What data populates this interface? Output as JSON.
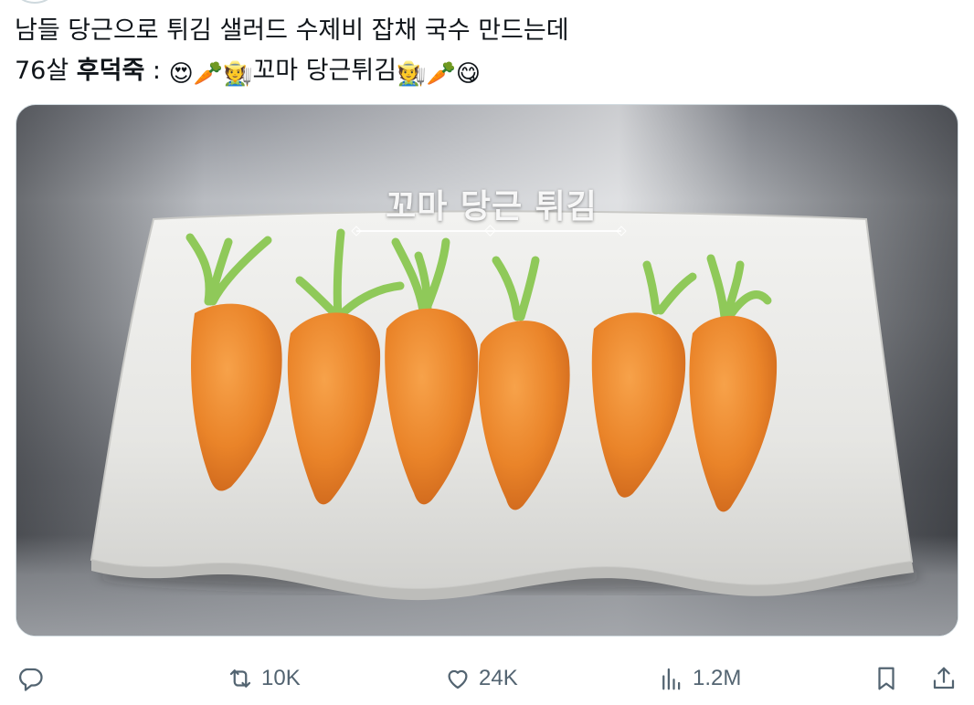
{
  "tweet": {
    "line1": "남들 당근으로 튀김 샐러드 수제비 잡채 국수 만드는데",
    "line2_prefix": "76살 ",
    "line2_bold": "후덕죽",
    "line2_colon": " : ",
    "line2_mid": "꼬마 당근튀김",
    "emoji": {
      "heart_eyes": "😍",
      "carrot": "🥕",
      "farmer": "🧑‍🌾",
      "yum": "😋"
    }
  },
  "media": {
    "caption": "꼬마 당근 튀김"
  },
  "actions": {
    "reply_count": "",
    "retweet_count": "10K",
    "like_count": "24K",
    "views_count": "1.2M"
  },
  "colors": {
    "text": "#0f1419",
    "icon": "#536471",
    "carrot_orange": "#e8822a",
    "stem_green": "#8cc850"
  }
}
